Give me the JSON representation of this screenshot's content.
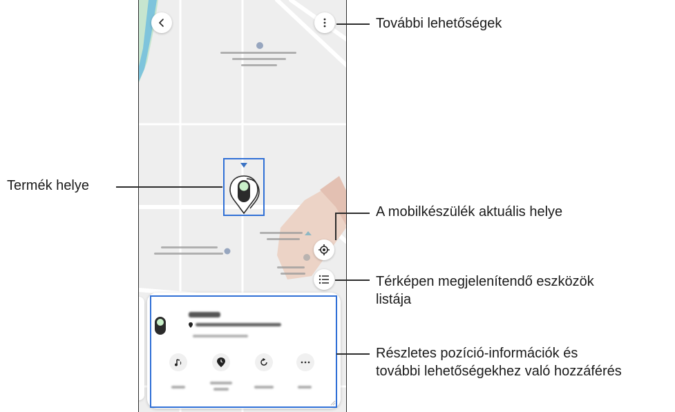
{
  "callouts": {
    "more_options": "További lehetőségek",
    "product_location": "Termék helye",
    "mobile_location": "A mobilkészülék aktuális helye",
    "device_list_line1": "Térképen megjelenítendő eszközök",
    "device_list_line2": "listája",
    "details_line1": "Részletes pozíció-információk és",
    "details_line2": "további lehetőségekhez való hozzáférés"
  },
  "icons": {
    "back": "chevron-left-icon",
    "more": "vertical-dots-icon",
    "locate": "crosshair-location-icon",
    "list": "list-icon",
    "tag": "smarttag-icon",
    "ring": "music-note-icon",
    "history": "location-history-icon",
    "refresh": "refresh-icon",
    "more_actions": "horizontal-dots-icon"
  },
  "colors": {
    "highlight_frame": "#2f6fd6",
    "map_background": "#eeeeee",
    "river": "#7ec4dc",
    "park": "#c6e5cf"
  }
}
